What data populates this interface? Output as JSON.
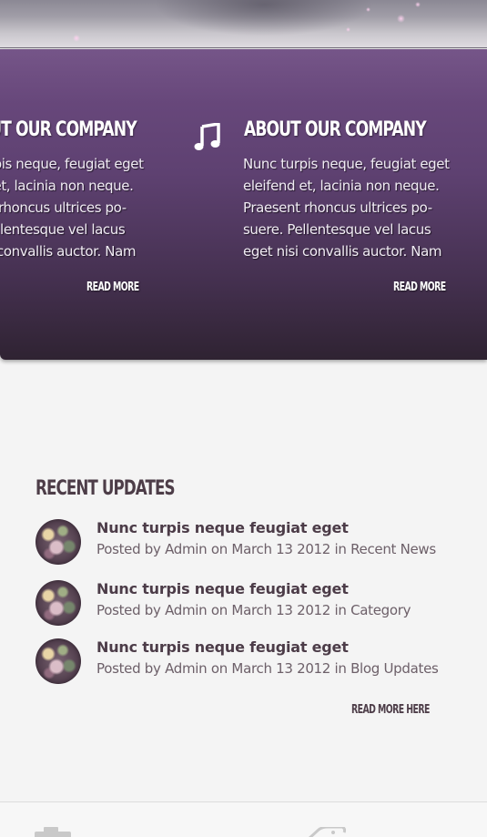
{
  "features": [
    {
      "title": "ABOUT OUR COMPANY",
      "text": "Nunc turpis neque, feugiat eget eleifend et, lacinia non neque. Praesent rhoncus ultrices po-suere. Pellentesque vel lacus eget nisi convallis auctor. Nam",
      "read_more": "READ MORE"
    },
    {
      "title": "ABOUT OUR COMPANY",
      "text": "Nunc turpis neque, feugiat eget eleifend et, lacinia non neque. Praesent rhoncus ultrices po-suere. Pellentesque vel lacus eget nisi convallis auctor. Nam",
      "read_more": "READ MORE",
      "icon": "music-note-icon"
    }
  ],
  "recent_updates": {
    "title": "RECENT UPDATES",
    "items": [
      {
        "title": "Nunc turpis neque feugiat eget",
        "posted_by": "Posted by",
        "author": "Admin",
        "on": "on",
        "date": "March 13 2012",
        "in": "in",
        "category": "Recent News"
      },
      {
        "title": "Nunc turpis neque feugiat eget",
        "posted_by": "Posted by",
        "author": "Admin",
        "on": "on",
        "date": "March 13 2012",
        "in": "in",
        "category": "Category"
      },
      {
        "title": "Nunc turpis neque feugiat eget",
        "posted_by": "Posted by",
        "author": "Admin",
        "on": "on",
        "date": "March 13 2012",
        "in": "in",
        "category": "Blog Updates"
      }
    ],
    "read_more": "READ MORE HERE"
  },
  "footer": {
    "icons": [
      "camera-icon",
      "tag-icon"
    ]
  },
  "colors": {
    "band_top": "#6e4c82",
    "band_bottom": "#2f2332",
    "heading": "#4d3d48",
    "meta_text": "#6d6069",
    "page_background": "#f4f4f4"
  }
}
